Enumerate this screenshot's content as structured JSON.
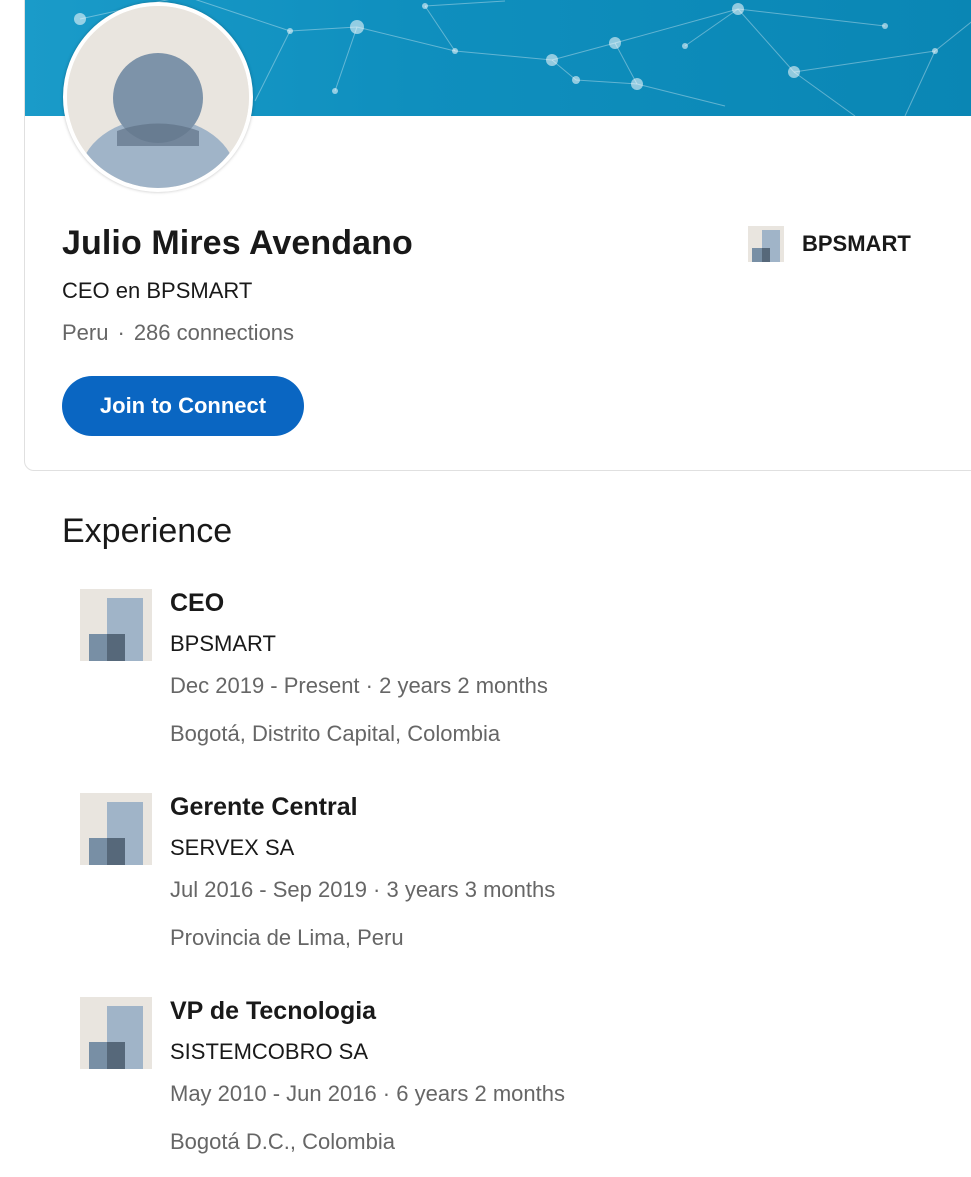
{
  "profile": {
    "name": "Julio Mires Avendano",
    "headline": "CEO en BPSMART",
    "location": "Peru",
    "separator": "·",
    "connections": "286 connections",
    "join_button_label": "Join to Connect",
    "current_company": "BPSMART"
  },
  "experience": {
    "title": "Experience",
    "items": [
      {
        "role": "CEO",
        "company": "BPSMART",
        "dates": "Dec 2019 - Present · 2 years 2 months",
        "location": "Bogotá, Distrito Capital, Colombia"
      },
      {
        "role": "Gerente Central",
        "company": "SERVEX SA",
        "dates": "Jul 2016 - Sep 2019 · 3 years 3 months",
        "location": "Provincia de Lima, Peru"
      },
      {
        "role": "VP de Tecnologia",
        "company": "SISTEMCOBRO SA",
        "dates": "May 2010 - Jun 2016 · 6 years 2 months",
        "location": "Bogotá D.C., Colombia"
      }
    ]
  },
  "icons": {
    "avatar": "default-person-icon",
    "company_logo": "company-placeholder-icon"
  },
  "colors": {
    "primary_button": "#0a66c2",
    "banner": "#0f8fbe",
    "secondary_text": "#666666"
  }
}
